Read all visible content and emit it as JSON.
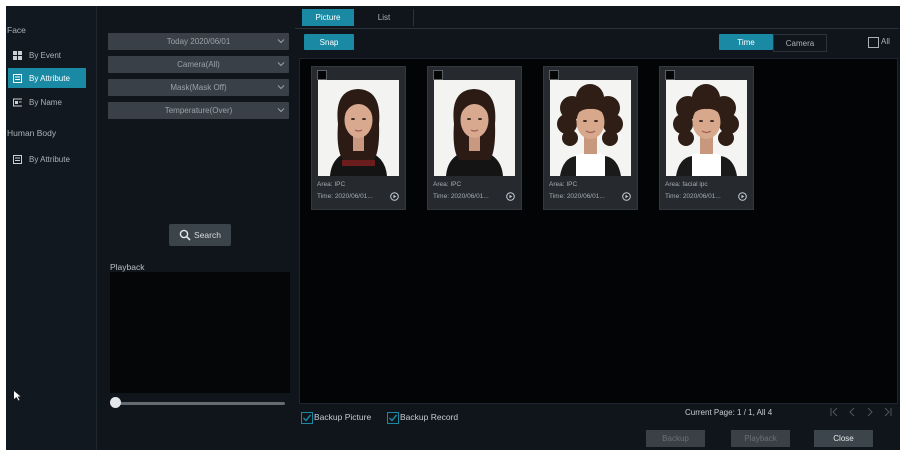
{
  "nav": {
    "face_section": "Face",
    "face_items": [
      {
        "label": "By Event",
        "icon": "grid-icon"
      },
      {
        "label": "By Attribute",
        "icon": "list-icon"
      },
      {
        "label": "By Name",
        "icon": "id-card-icon"
      }
    ],
    "body_section": "Human Body",
    "body_items": [
      {
        "label": "By Attribute",
        "icon": "list-icon"
      }
    ]
  },
  "filters": {
    "date": "Today 2020/06/01",
    "camera": "Camera(All)",
    "mask": "Mask(Mask Off)",
    "temperature": "Temperature(Over)",
    "search_label": "Search",
    "playback_label": "Playback",
    "playback_progress": 0
  },
  "tabs": {
    "picture": "Picture",
    "list": "List",
    "active": "Picture"
  },
  "toolbar": {
    "snap": "Snap",
    "sort_time": "Time",
    "sort_camera": "Camera",
    "active_sort": "Time",
    "all_label": "All"
  },
  "cards": [
    {
      "area": "Area:  IPC",
      "time": "Time:  2020/06/01...",
      "photo": "woman-straight-hair",
      "overlay": true
    },
    {
      "area": "Area:  IPC",
      "time": "Time:  2020/06/01...",
      "photo": "woman-straight-hair",
      "overlay": false
    },
    {
      "area": "Area:  IPC",
      "time": "Time:  2020/06/01...",
      "photo": "woman-curly-hair",
      "overlay": false
    },
    {
      "area": "Area:  facial ipc",
      "time": "Time:  2020/06/01...",
      "photo": "woman-curly-hair",
      "overlay": false
    }
  ],
  "footer": {
    "backup_picture": "Backup Picture",
    "backup_record": "Backup Record",
    "page_info": "Current Page: 1 / 1, All 4",
    "backup_button": "Backup",
    "playback_button": "Playback",
    "close_button": "Close"
  },
  "colors": {
    "accent": "#1a8aa4",
    "background": "#10151c"
  }
}
